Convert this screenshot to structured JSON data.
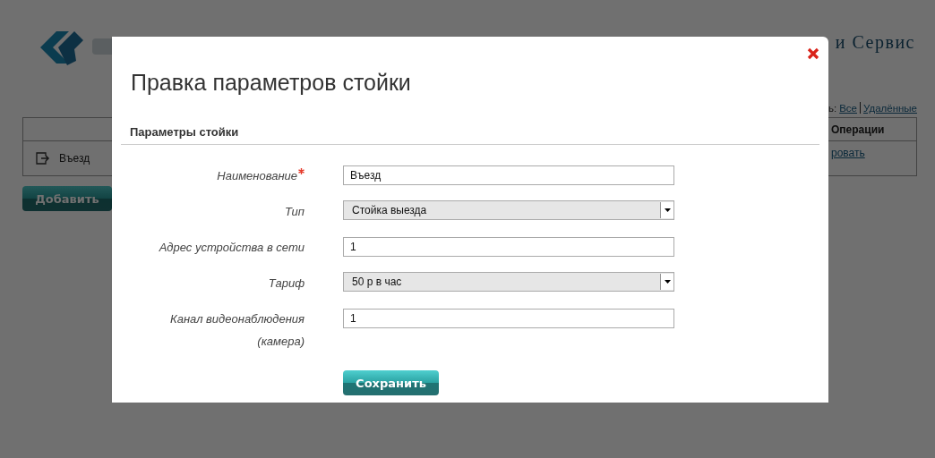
{
  "page": {
    "header_text": "и Сервис",
    "filter": {
      "prefix": "ь:",
      "links": [
        {
          "label": "Все"
        },
        {
          "label": "Удалённые"
        }
      ]
    },
    "table": {
      "operations_header": "Операции",
      "rows": [
        {
          "name": "Въезд",
          "operation": "ровать"
        }
      ]
    },
    "add_button": "Добавить"
  },
  "dialog": {
    "title": "Правка параметров стойки",
    "section": "Параметры стойки",
    "fields": [
      {
        "label": "Наименование",
        "required": true,
        "kind": "input",
        "value": "Въезд"
      },
      {
        "label": "Тип",
        "required": false,
        "kind": "select",
        "value": "Стойка выезда"
      },
      {
        "label": "Адрес устройства в сети",
        "required": false,
        "kind": "input",
        "value": "1"
      },
      {
        "label": "Тариф",
        "required": false,
        "kind": "select",
        "value": "50 р в час"
      },
      {
        "label": "Канал видеонаблюдения (камера)",
        "required": false,
        "kind": "input",
        "value": "1"
      }
    ],
    "save_button": "Сохранить"
  }
}
